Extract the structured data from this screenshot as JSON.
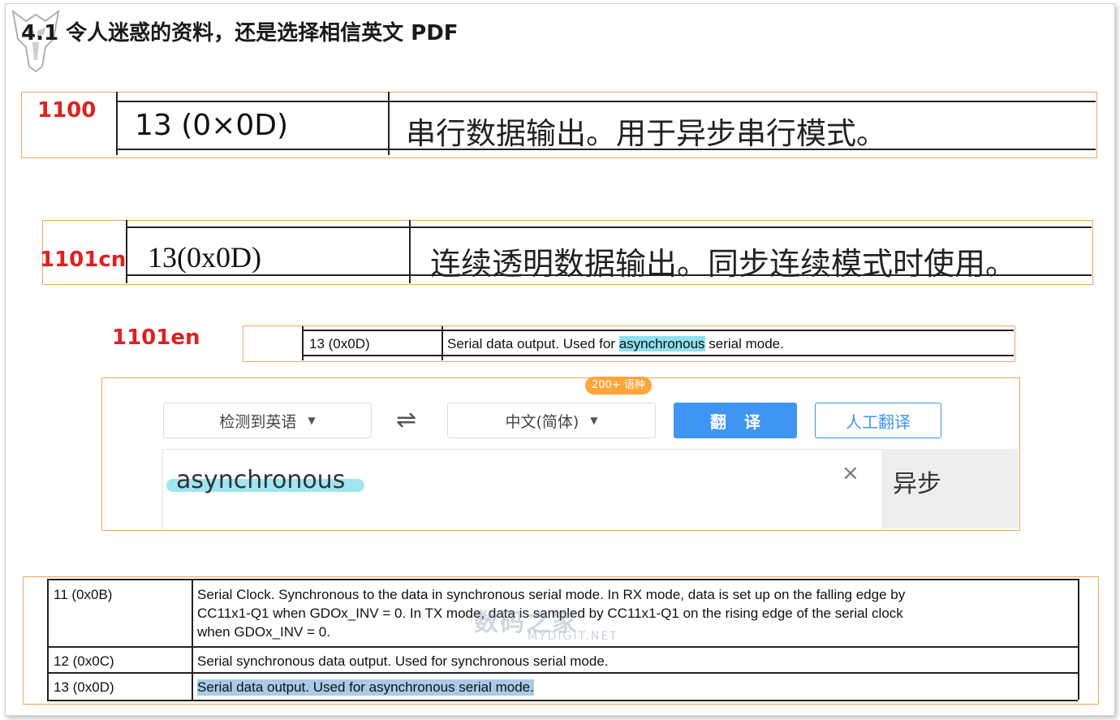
{
  "section": {
    "title": "4.1 令人迷惑的资料，还是选择相信英文 PDF"
  },
  "labels": {
    "l1100": "1100",
    "l1101cn": "1101cn",
    "l1101en": "1101en"
  },
  "row_1100": {
    "code": "13 (0×0D)",
    "desc": "串行数据输出。用于异步串行模式。"
  },
  "row_1101cn": {
    "code": "13(0x0D)",
    "desc": "连续透明数据输出。同步连续模式时使用。"
  },
  "row_1101en": {
    "code": "13 (0x0D)",
    "desc_before": "Serial data output. Used for ",
    "desc_highlight": "asynchronous",
    "desc_after": " serial mode."
  },
  "translator": {
    "source_lang": "检测到英语",
    "swap_icon": "⇌",
    "target_lang": "中文(简体)",
    "badge": "200+ 语种",
    "translate_label": "翻译",
    "human_label": "人工翻译",
    "input_value": "asynchronous",
    "clear_icon": "×",
    "result": "异步"
  },
  "bottom_table": {
    "rows": [
      {
        "code": "11 (0x0B)",
        "lines": [
          "Serial Clock. Synchronous to the data in synchronous serial mode. In RX mode, data is set up on the falling edge by",
          "CC11x1-Q1 when GDOx_INV = 0. In TX mode, data is sampled by CC11x1-Q1 on the rising edge of the serial clock",
          "when GDOx_INV = 0."
        ]
      },
      {
        "code": "12 (0x0C)",
        "lines": [
          "Serial synchronous data output. Used for synchronous serial mode."
        ]
      },
      {
        "code": "13 (0x0D)",
        "lines": [
          "Serial data output. Used for asynchronous serial mode."
        ]
      }
    ]
  },
  "watermark": {
    "main": "数码之家",
    "sub": "MYDIGIT.NET"
  },
  "colors": {
    "orange": "#f0a45a",
    "red": "#e02020",
    "blue": "#3e95f2",
    "highlight": "#8fe0ee",
    "selection": "#a9cbe8"
  }
}
